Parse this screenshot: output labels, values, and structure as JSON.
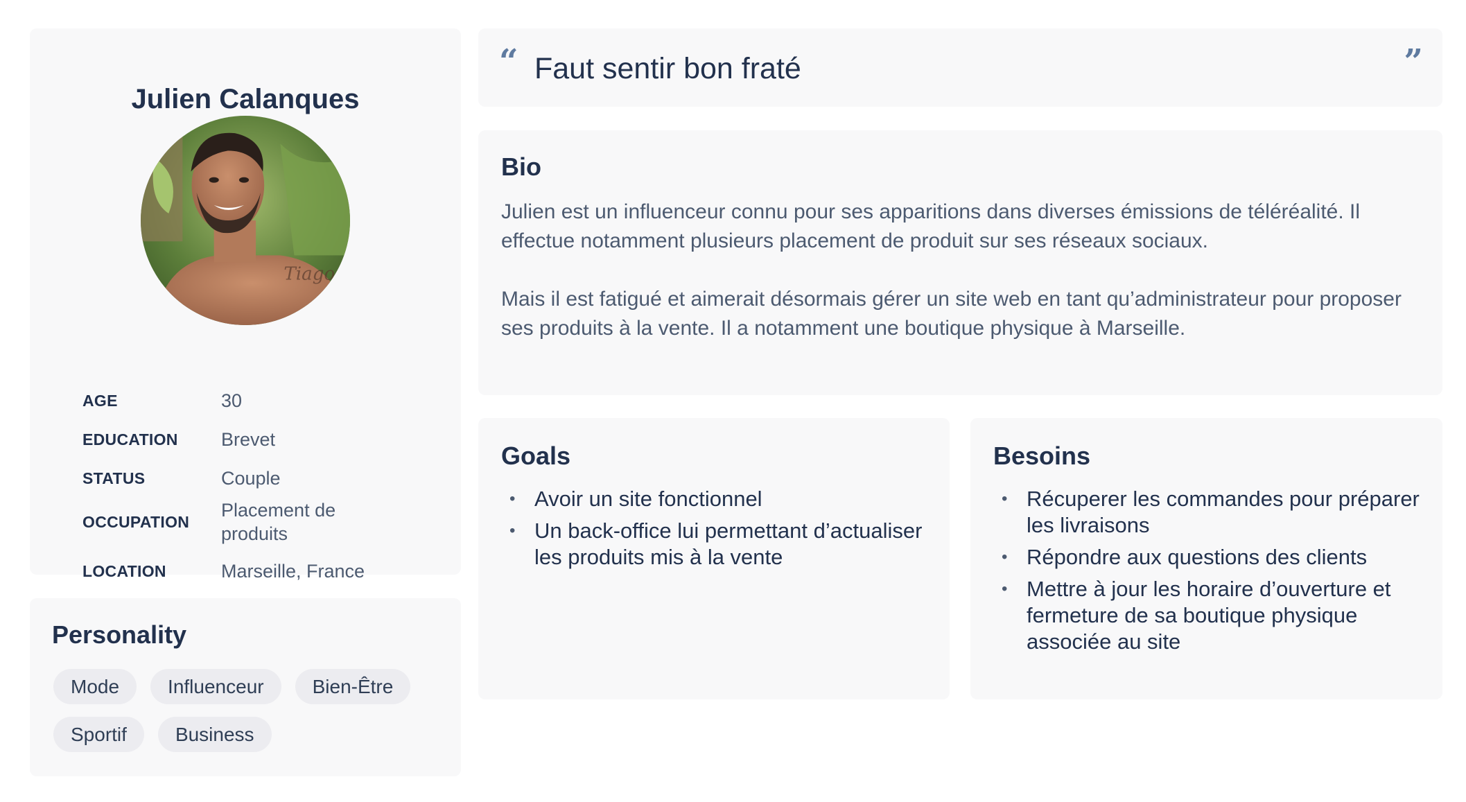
{
  "profile": {
    "name": "Julien Calanques",
    "info": [
      {
        "key": "AGE",
        "value": "30"
      },
      {
        "key": "EDUCATION",
        "value": "Brevet"
      },
      {
        "key": "STATUS",
        "value": "Couple"
      },
      {
        "key": "OCCUPATION",
        "value": "Placement de produits"
      },
      {
        "key": "LOCATION",
        "value": "Marseille, France"
      }
    ]
  },
  "personality": {
    "title": "Personality",
    "tags": [
      "Mode",
      "Influenceur",
      "Bien-Être",
      "Sportif",
      "Business"
    ]
  },
  "quote": {
    "text": "Faut sentir bon fraté",
    "open_mark": "“",
    "close_mark": "”"
  },
  "bio": {
    "title": "Bio",
    "paragraphs": [
      "Julien est un influenceur connu pour ses apparitions dans diverses émissions de téléréalité. Il effectue notamment plusieurs placement de produit sur ses réseaux sociaux.",
      "Mais il est fatigué et aimerait désormais gérer un site web en tant qu’administrateur pour proposer ses produits à la vente. Il a notamment une boutique physique à Marseille."
    ]
  },
  "goals": {
    "title": "Goals",
    "items": [
      "Avoir un site fonctionnel",
      "Un back-office lui permettant d’actualiser les produits mis à la vente"
    ]
  },
  "needs": {
    "title": "Besoins",
    "items": [
      "Récuperer les commandes pour préparer les livraisons",
      "Répondre aux questions des clients",
      "Mettre à jour les horaire d’ouverture et fermeture de sa boutique physique associée au site"
    ]
  },
  "colors": {
    "card_bg": "#f8f8f9",
    "heading": "#22314d",
    "body_text": "#4c5a70",
    "quote_mark": "#5f7ba0",
    "tag_bg": "#ececf0"
  },
  "icons": {
    "quote_open": "quote-open-icon",
    "quote_close": "quote-close-icon",
    "bullet": "bullet-icon"
  }
}
